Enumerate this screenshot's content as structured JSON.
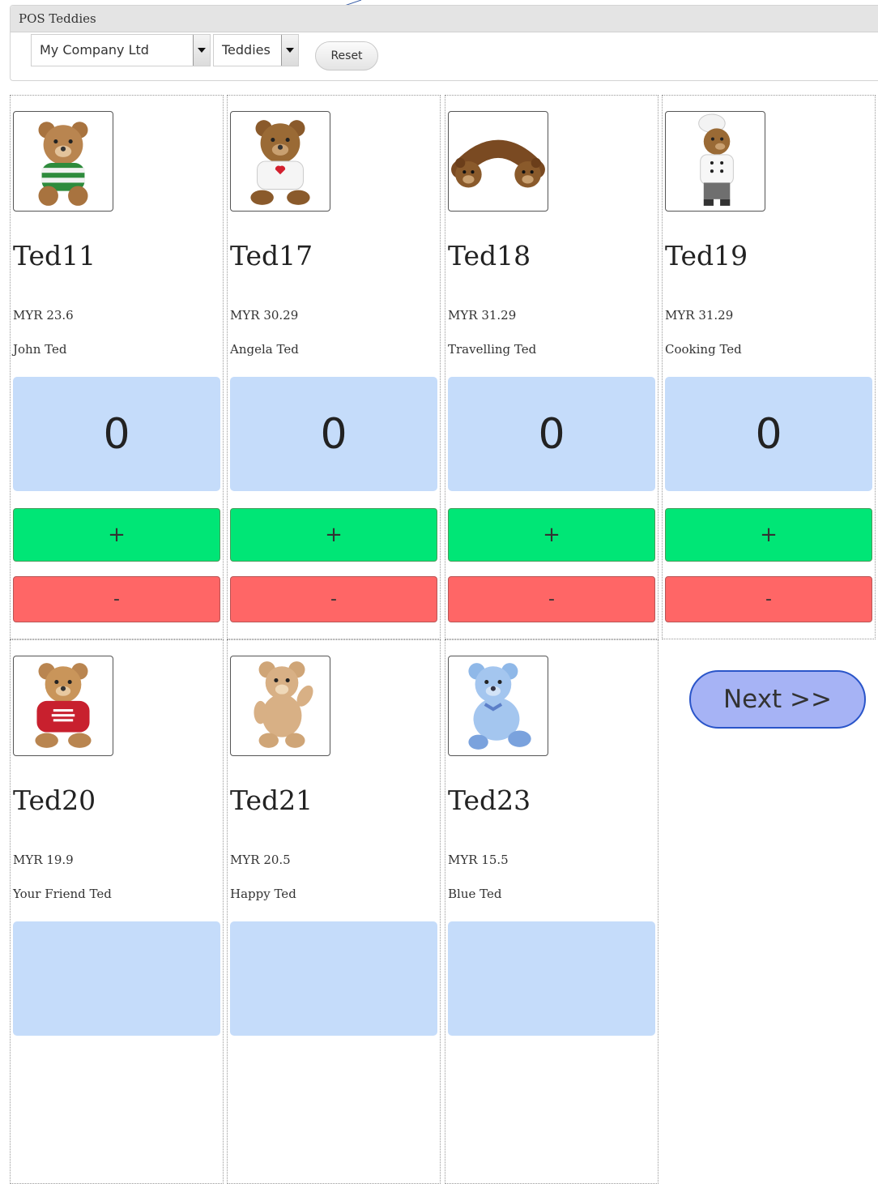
{
  "panel": {
    "title": "POS Teddies",
    "company_select": {
      "value": "My Company Ltd"
    },
    "category_select": {
      "value": "Teddies"
    },
    "reset_label": "Reset"
  },
  "products": [
    {
      "code": "Ted11",
      "price": "MYR 23.6",
      "name": "John Ted",
      "qty": "0",
      "plus_label": "+",
      "minus_label": "-",
      "image": "teddy-green-shirt"
    },
    {
      "code": "Ted17",
      "price": "MYR 30.29",
      "name": "Angela Ted",
      "qty": "0",
      "plus_label": "+",
      "minus_label": "-",
      "image": "teddy-heart-shirt"
    },
    {
      "code": "Ted18",
      "price": "MYR 31.29",
      "name": "Travelling Ted",
      "qty": "0",
      "plus_label": "+",
      "minus_label": "-",
      "image": "teddy-neck-pillow"
    },
    {
      "code": "Ted19",
      "price": "MYR 31.29",
      "name": "Cooking Ted",
      "qty": "0",
      "plus_label": "+",
      "minus_label": "-",
      "image": "teddy-chef"
    },
    {
      "code": "Ted20",
      "price": "MYR 19.9",
      "name": "Your Friend Ted",
      "image": "teddy-red-hoodie"
    },
    {
      "code": "Ted21",
      "price": "MYR 20.5",
      "name": "Happy Ted",
      "image": "teddy-plain"
    },
    {
      "code": "Ted23",
      "price": "MYR 15.5",
      "name": "Blue Ted",
      "image": "teddy-blue"
    }
  ],
  "pager": {
    "next_label": "Next >>"
  },
  "colors": {
    "qty_bg": "#c5dcfa",
    "plus_bg": "#00e676",
    "minus_bg": "#ff6666",
    "next_bg": "#a6b3f5",
    "next_border": "#2a55c9"
  }
}
